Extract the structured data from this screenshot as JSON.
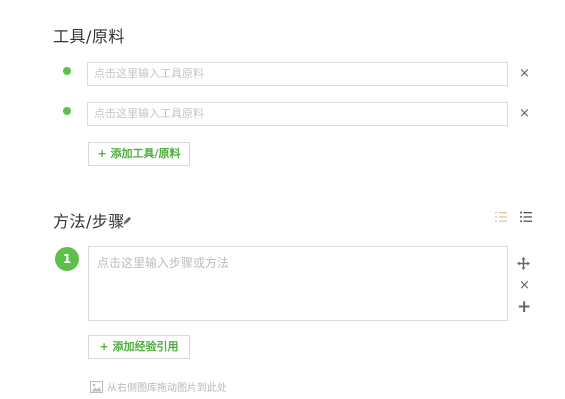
{
  "tools": {
    "heading": "工具/原料",
    "items": [
      {
        "placeholder": "点击这里输入工具原料"
      },
      {
        "placeholder": "点击这里输入工具原料"
      }
    ],
    "remove_label": "×",
    "add_label": "+ 添加工具/原料"
  },
  "steps": {
    "heading": "方法/步骤",
    "items": [
      {
        "number": "1",
        "placeholder": "点击这里输入步骤或方法"
      }
    ],
    "remove_label": "×",
    "insert_label": "+",
    "add_reference_label": "+ 添加经验引用",
    "image_hint": "从右侧图库拖动图片到此处"
  },
  "colors": {
    "accent": "#5cc04a",
    "accent_text": "#4fae3f",
    "border": "#dcdcdc",
    "placeholder": "#c4c4c4"
  },
  "icons": [
    "pencil-icon",
    "numbered-list-icon",
    "bulleted-list-icon",
    "move-icon",
    "close-icon",
    "plus-icon",
    "image-icon"
  ]
}
